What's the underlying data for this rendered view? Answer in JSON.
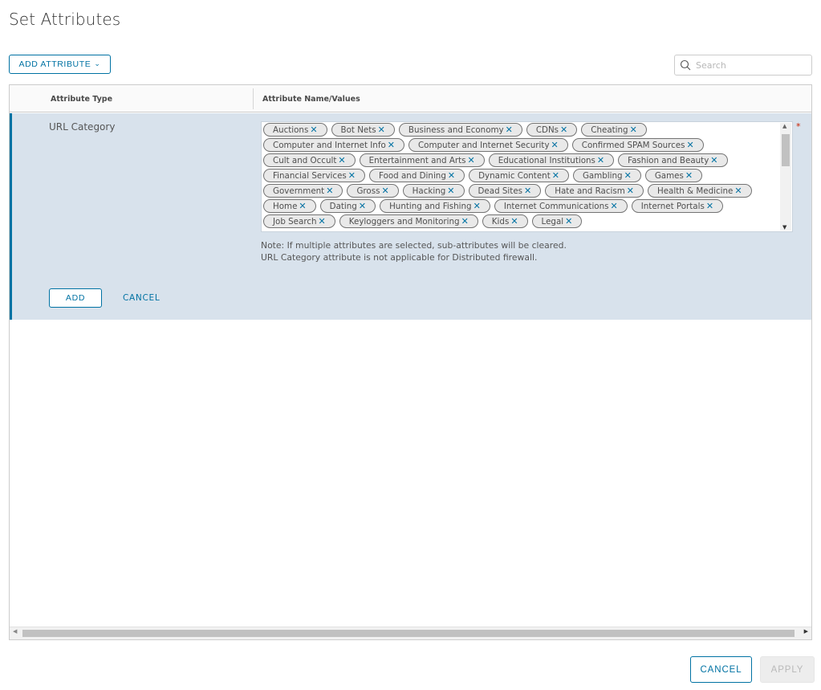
{
  "page": {
    "title": "Set Attributes"
  },
  "toolbar": {
    "add_attribute_label": "ADD ATTRIBUTE",
    "search_placeholder": "Search"
  },
  "grid": {
    "columns": [
      "Attribute Type",
      "Attribute Name/Values"
    ],
    "edit_row": {
      "attribute_type": "URL Category",
      "tags": [
        "Auctions",
        "Bot Nets",
        "Business and Economy",
        "CDNs",
        "Cheating",
        "Computer and Internet Info",
        "Computer and Internet Security",
        "Confirmed SPAM Sources",
        "Cult and Occult",
        "Entertainment and Arts",
        "Educational Institutions",
        "Fashion and Beauty",
        "Financial Services",
        "Food and Dining",
        "Dynamic Content",
        "Gambling",
        "Games",
        "Government",
        "Gross",
        "Hacking",
        "Dead Sites",
        "Hate and Racism",
        "Health & Medicine",
        "Home",
        "Dating",
        "Hunting and Fishing",
        "Internet Communications",
        "Internet Portals",
        "Job Search",
        "Keyloggers and Monitoring",
        "Kids",
        "Legal"
      ],
      "tag_remove_glyph": "✕",
      "required_marker": "*",
      "note_line1": "Note: If multiple attributes are selected, sub-attributes will be cleared.",
      "note_line2": "URL Category attribute is not applicable for Distributed firewall.",
      "add_label": "ADD",
      "cancel_label": "CANCEL"
    }
  },
  "footer": {
    "cancel_label": "CANCEL",
    "apply_label": "APPLY"
  },
  "colors": {
    "accent": "#0072a3",
    "edit_row_bg": "#d8e2ec",
    "required": "#c92100"
  }
}
